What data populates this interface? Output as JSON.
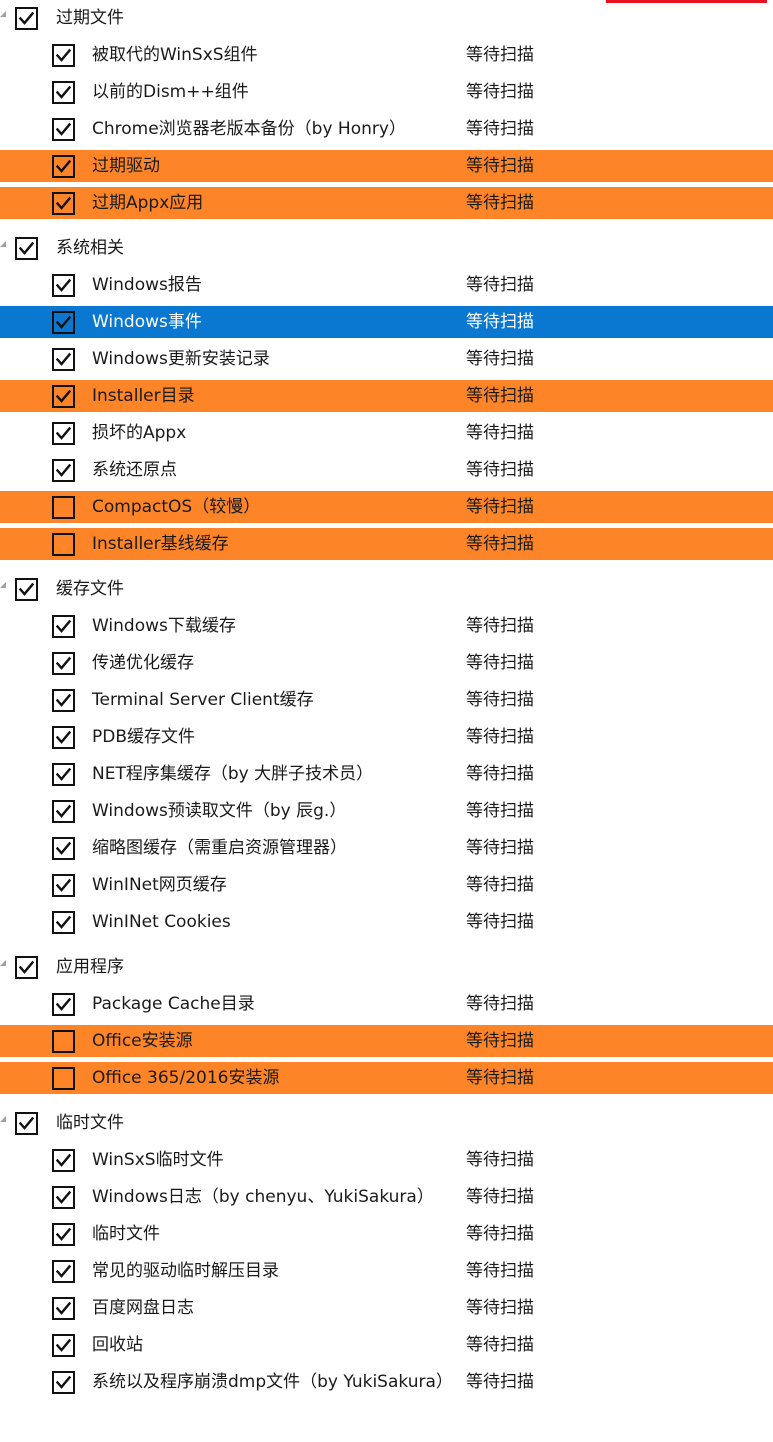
{
  "groups": [
    {
      "label": "过期文件",
      "checked": true,
      "items": [
        {
          "label": "被取代的WinSxS组件",
          "status": "等待扫描",
          "checked": true,
          "highlight": "none"
        },
        {
          "label": "以前的Dism++组件",
          "status": "等待扫描",
          "checked": true,
          "highlight": "none"
        },
        {
          "label": "Chrome浏览器老版本备份（by Honry）",
          "status": "等待扫描",
          "checked": true,
          "highlight": "none"
        },
        {
          "label": "过期驱动",
          "status": "等待扫描",
          "checked": true,
          "highlight": "orange"
        },
        {
          "label": "过期Appx应用",
          "status": "等待扫描",
          "checked": true,
          "highlight": "orange"
        }
      ]
    },
    {
      "label": "系统相关",
      "checked": true,
      "items": [
        {
          "label": "Windows报告",
          "status": "等待扫描",
          "checked": true,
          "highlight": "none"
        },
        {
          "label": "Windows事件",
          "status": "等待扫描",
          "checked": true,
          "highlight": "selected"
        },
        {
          "label": "Windows更新安装记录",
          "status": "等待扫描",
          "checked": true,
          "highlight": "none"
        },
        {
          "label": "Installer目录",
          "status": "等待扫描",
          "checked": true,
          "highlight": "orange"
        },
        {
          "label": "损坏的Appx",
          "status": "等待扫描",
          "checked": true,
          "highlight": "none"
        },
        {
          "label": "系统还原点",
          "status": "等待扫描",
          "checked": true,
          "highlight": "none"
        },
        {
          "label": "CompactOS（较慢）",
          "status": "等待扫描",
          "checked": false,
          "highlight": "orange"
        },
        {
          "label": "Installer基线缓存",
          "status": "等待扫描",
          "checked": false,
          "highlight": "orange"
        }
      ]
    },
    {
      "label": "缓存文件",
      "checked": true,
      "items": [
        {
          "label": "Windows下载缓存",
          "status": "等待扫描",
          "checked": true,
          "highlight": "none"
        },
        {
          "label": "传递优化缓存",
          "status": "等待扫描",
          "checked": true,
          "highlight": "none"
        },
        {
          "label": "Terminal Server Client缓存",
          "status": "等待扫描",
          "checked": true,
          "highlight": "none"
        },
        {
          "label": "PDB缓存文件",
          "status": "等待扫描",
          "checked": true,
          "highlight": "none"
        },
        {
          "label": "NET程序集缓存（by 大胖子技术员）",
          "status": "等待扫描",
          "checked": true,
          "highlight": "none"
        },
        {
          "label": "Windows预读取文件（by 辰g.）",
          "status": "等待扫描",
          "checked": true,
          "highlight": "none"
        },
        {
          "label": "缩略图缓存（需重启资源管理器）",
          "status": "等待扫描",
          "checked": true,
          "highlight": "none"
        },
        {
          "label": "WinINet网页缓存",
          "status": "等待扫描",
          "checked": true,
          "highlight": "none"
        },
        {
          "label": "WinINet Cookies",
          "status": "等待扫描",
          "checked": true,
          "highlight": "none"
        }
      ]
    },
    {
      "label": "应用程序",
      "checked": true,
      "items": [
        {
          "label": "Package Cache目录",
          "status": "等待扫描",
          "checked": true,
          "highlight": "none"
        },
        {
          "label": "Office安装源",
          "status": "等待扫描",
          "checked": false,
          "highlight": "orange"
        },
        {
          "label": "Office 365/2016安装源",
          "status": "等待扫描",
          "checked": false,
          "highlight": "orange"
        }
      ]
    },
    {
      "label": "临时文件",
      "checked": true,
      "items": [
        {
          "label": "WinSxS临时文件",
          "status": "等待扫描",
          "checked": true,
          "highlight": "none"
        },
        {
          "label": "Windows日志（by chenyu、YukiSakura）",
          "status": "等待扫描",
          "checked": true,
          "highlight": "none"
        },
        {
          "label": "临时文件",
          "status": "等待扫描",
          "checked": true,
          "highlight": "none"
        },
        {
          "label": "常见的驱动临时解压目录",
          "status": "等待扫描",
          "checked": true,
          "highlight": "none"
        },
        {
          "label": "百度网盘日志",
          "status": "等待扫描",
          "checked": true,
          "highlight": "none"
        },
        {
          "label": "回收站",
          "status": "等待扫描",
          "checked": true,
          "highlight": "none"
        },
        {
          "label": "系统以及程序崩溃dmp文件（by YukiSakura）",
          "status": "等待扫描",
          "checked": true,
          "highlight": "none"
        }
      ]
    }
  ],
  "colors": {
    "orange": "#fd8427",
    "selected": "#0a78d0",
    "accent_bar": "#e81123"
  }
}
